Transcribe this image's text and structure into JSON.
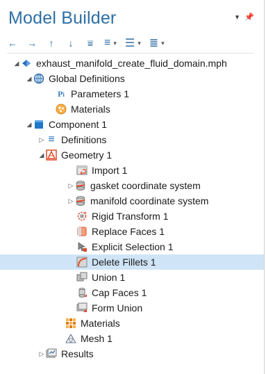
{
  "header": {
    "title": "Model Builder"
  },
  "toolbar": {
    "icons": [
      "arrow-left-icon",
      "arrow-right-icon",
      "arrow-up-icon",
      "arrow-down-icon",
      "filter-icon",
      "sort-icon",
      "expand-icon",
      "view-menu-icon"
    ]
  },
  "tree": {
    "items": [
      {
        "label": "exhaust_manifold_create_fluid_domain.mph"
      },
      {
        "label": "Global Definitions"
      },
      {
        "label": "Parameters 1"
      },
      {
        "label": "Materials"
      },
      {
        "label": "Component 1"
      },
      {
        "label": "Definitions"
      },
      {
        "label": "Geometry 1"
      },
      {
        "label": "Import 1"
      },
      {
        "label": "gasket coordinate system"
      },
      {
        "label": "manifold coordinate system"
      },
      {
        "label": "Rigid Transform 1"
      },
      {
        "label": "Replace Faces 1"
      },
      {
        "label": "Explicit Selection 1"
      },
      {
        "label": "Delete Fillets 1"
      },
      {
        "label": "Union 1"
      },
      {
        "label": "Cap Faces 1"
      },
      {
        "label": "Form Union"
      },
      {
        "label": "Materials"
      },
      {
        "label": "Mesh 1"
      },
      {
        "label": "Results"
      }
    ]
  },
  "colors": {
    "title": "#2e6fa4",
    "selection": "#cfe5f7"
  }
}
